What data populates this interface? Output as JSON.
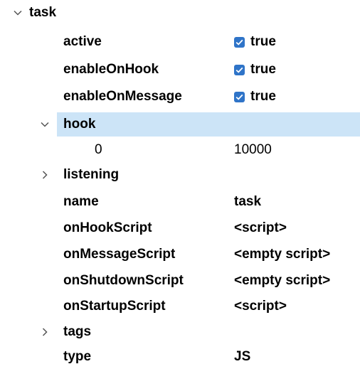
{
  "tree": {
    "root": {
      "label": "task",
      "expanded": true
    },
    "active": {
      "key": "active",
      "value": "true",
      "checked": true
    },
    "enableOnHook": {
      "key": "enableOnHook",
      "value": "true",
      "checked": true
    },
    "enableOnMessage": {
      "key": "enableOnMessage",
      "value": "true",
      "checked": true
    },
    "hook": {
      "key": "hook",
      "expanded": true,
      "selected": true,
      "items": [
        {
          "index": "0",
          "value": "10000"
        }
      ]
    },
    "listening": {
      "key": "listening",
      "expanded": false
    },
    "name": {
      "key": "name",
      "value": "task"
    },
    "onHookScript": {
      "key": "onHookScript",
      "value": "<script>"
    },
    "onMessageScript": {
      "key": "onMessageScript",
      "value": "<empty script>"
    },
    "onShutdownScript": {
      "key": "onShutdownScript",
      "value": "<empty script>"
    },
    "onStartupScript": {
      "key": "onStartupScript",
      "value": "<script>"
    },
    "tags": {
      "key": "tags",
      "expanded": false
    },
    "type": {
      "key": "type",
      "value": "JS"
    }
  },
  "colors": {
    "selection": "#cce4f7",
    "checkbox": "#2f74c8",
    "chevron": "#555555"
  },
  "icons": {
    "expanded": "chevron-down-icon",
    "collapsed": "chevron-right-icon",
    "check": "check-icon"
  }
}
